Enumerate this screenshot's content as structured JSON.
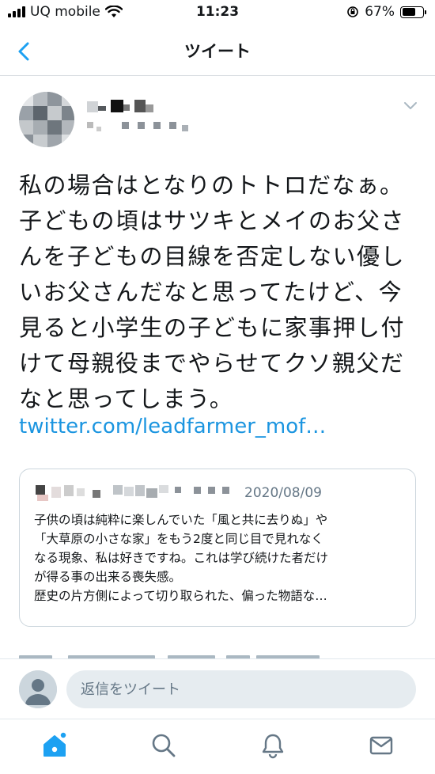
{
  "status_bar": {
    "carrier": "UQ mobile",
    "time": "11:23",
    "battery_percent": "67%",
    "battery_level": 0.67
  },
  "nav": {
    "title": "ツイート",
    "back_icon": "chevron-left-icon"
  },
  "tweet": {
    "text": "私の場合はとなりのトトロだなぁ。子どもの頃はサツキとメイのお父さんを子どもの目線を否定しない優しいお父さんだなと思ってたけど、今見ると小学生の子どもに家事押し付けて母親役までやらせてクソ親父だなと思ってしまう。",
    "link": "twitter.com/leadfarmer_mof…"
  },
  "quoted": {
    "date": "2020/08/09",
    "lines": [
      "子供の頃は純粋に楽しんでいた「風と共に去りぬ」や",
      "「大草原の小さな家」をもう2度と同じ目で見れなく",
      "なる現象、私は好きですね。これは学び続けた者だけ",
      "が得る事の出来る喪失感。",
      "歴史の片方側によって切り取られた、偏った物語な…"
    ]
  },
  "reply": {
    "placeholder": "返信をツイート"
  },
  "tabs": [
    {
      "icon": "home-icon",
      "active": true
    },
    {
      "icon": "search-icon",
      "active": false
    },
    {
      "icon": "bell-icon",
      "active": false
    },
    {
      "icon": "mail-icon",
      "active": false
    }
  ],
  "colors": {
    "accent": "#1da1f2",
    "link": "#1b95e0",
    "secondary_text": "#657786"
  }
}
